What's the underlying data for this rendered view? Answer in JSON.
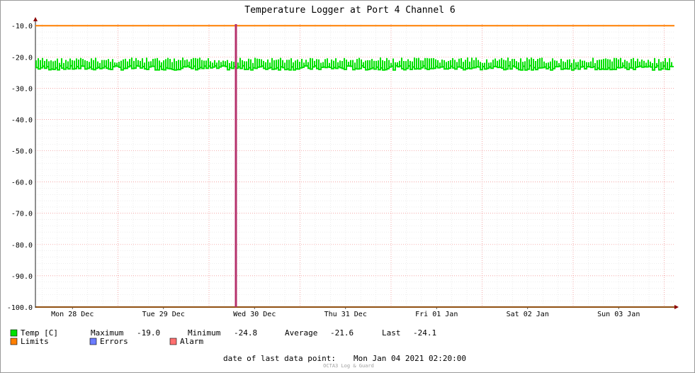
{
  "chart_data": {
    "type": "line",
    "title": "Temperature Logger at Port 4 Channel 6",
    "y_ticks": [
      "-10.0",
      "-20.0",
      "-30.0",
      "-40.0",
      "-50.0",
      "-60.0",
      "-70.0",
      "-80.0",
      "-90.0",
      "-100.0"
    ],
    "ylim": [
      -100,
      -9.5
    ],
    "x_ticks": [
      "Mon 28 Dec",
      "Tue 29 Dec",
      "Wed 30 Dec",
      "Thu 31 Dec",
      "Fri 01 Jan",
      "Sat 02 Jan",
      "Sun 03 Jan"
    ],
    "series": [
      {
        "name": "Temp [C]",
        "color": "#00e000",
        "min": -24.8,
        "max": -19.0,
        "average": -21.6,
        "last": -24.1
      },
      {
        "name": "Limits",
        "color": "#ff7f00",
        "value": -10.0
      },
      {
        "name": "Errors",
        "color": "#6b7cff"
      },
      {
        "name": "Alarm",
        "color": "#ff6f6f"
      }
    ],
    "event_line": {
      "color": "#b5316b",
      "position_label": "Wed 30 Dec"
    },
    "grid": true
  },
  "legend": {
    "temp_label": "Temp [C]",
    "maximum_label": "Maximum",
    "maximum_value": "-19.0",
    "minimum_label": "Minimum",
    "minimum_value": "-24.8",
    "average_label": "Average",
    "average_value": "-21.6",
    "last_label": "Last",
    "last_value": "-24.1",
    "limits_label": "Limits",
    "errors_label": "Errors",
    "alarm_label": "Alarm"
  },
  "footer": {
    "last_point_label": "date of last data point:",
    "last_point_value": "Mon Jan 04 2021 02:20:00",
    "watermark": "OCTA3 Log & Guard"
  }
}
